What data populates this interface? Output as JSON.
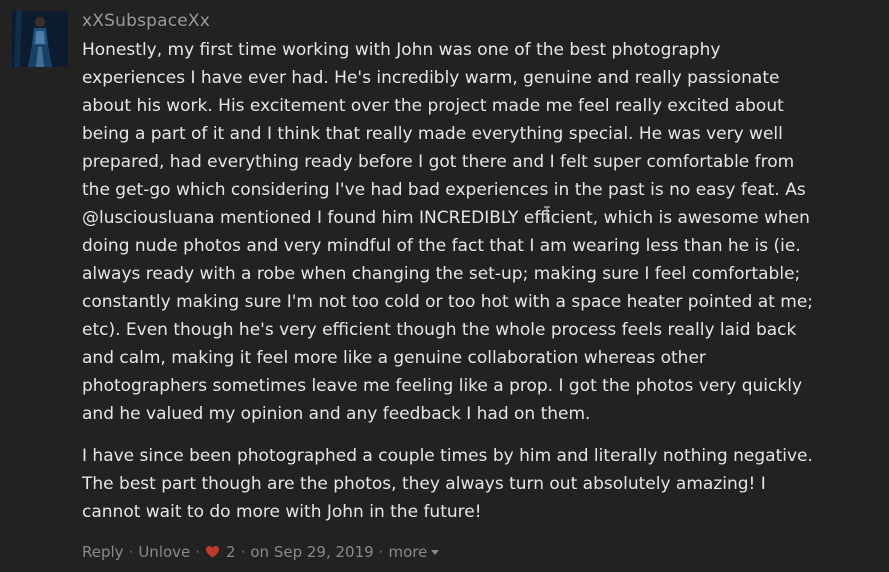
{
  "comment": {
    "username": "xXSubspaceXx",
    "avatar_icon": "user-avatar-photo",
    "paragraphs": [
      {
        "lines": [
          "Honestly, my first time working with John was one of the best photography",
          "experiences I have ever had. He's incredibly warm, genuine and really passionate",
          "about his work. His excitement over the project made me feel really excited about",
          "being a part of it and I think that really made everything special. He was very well",
          "prepared, had everything ready before I got there and I felt super comfortable from",
          "the get-go which considering I've had bad experiences in the past is no easy feat. As",
          "@lusciousluana mentioned I found him INCREDIBLY efficient, which is awesome when",
          "doing nude photos and very mindful of the fact that I am wearing less than he is (ie.",
          "always ready with a robe when changing the set-up; making sure I feel comfortable;",
          "constantly making sure I'm not too cold or too hot with a space heater pointed at me;",
          "etc). Even though he's very efficient though the whole process feels really laid back",
          "and calm, making it feel more like a genuine collaboration whereas other",
          "photographers sometimes leave me feeling like a prop. I got the photos very quickly",
          "and he valued my opinion and any feedback I had on them."
        ]
      },
      {
        "lines": [
          "I have since been photographed a couple times by him and literally nothing negative.",
          "The best part though are the photos, they always turn out absolutely amazing! I",
          "cannot wait to do more with John in the future!"
        ]
      }
    ],
    "actions": {
      "reply_label": "Reply",
      "unlove_label": "Unlove",
      "like_count": "2",
      "date_text": "on Sep 29, 2019",
      "more_label": "more",
      "separator": "·",
      "heart_color": "#c0392b"
    }
  }
}
